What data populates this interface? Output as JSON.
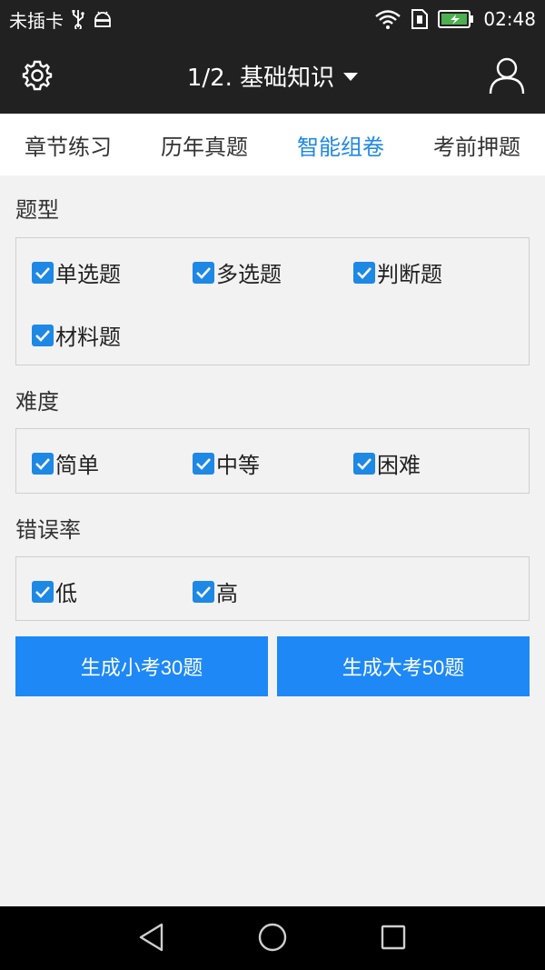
{
  "status_bar": {
    "carrier": "未插卡",
    "time": "02:48"
  },
  "app_bar": {
    "title": "1/2. 基础知识"
  },
  "tabs": [
    {
      "label": "章节练习",
      "active": false
    },
    {
      "label": "历年真题",
      "active": false
    },
    {
      "label": "智能组卷",
      "active": true
    },
    {
      "label": "考前押题",
      "active": false
    }
  ],
  "sections": {
    "type": {
      "title": "题型",
      "options": [
        {
          "label": "单选题",
          "checked": true
        },
        {
          "label": "多选题",
          "checked": true
        },
        {
          "label": "判断题",
          "checked": true
        },
        {
          "label": "材料题",
          "checked": true
        }
      ]
    },
    "difficulty": {
      "title": "难度",
      "options": [
        {
          "label": "简单",
          "checked": true
        },
        {
          "label": "中等",
          "checked": true
        },
        {
          "label": "困难",
          "checked": true
        }
      ]
    },
    "error_rate": {
      "title": "错误率",
      "options": [
        {
          "label": "低",
          "checked": true
        },
        {
          "label": "高",
          "checked": true
        }
      ]
    }
  },
  "buttons": {
    "small_exam": "生成小考30题",
    "big_exam": "生成大考50题"
  },
  "colors": {
    "accent": "#1e88e5",
    "bar_bg": "#212121",
    "page_bg": "#f2f2f2"
  }
}
